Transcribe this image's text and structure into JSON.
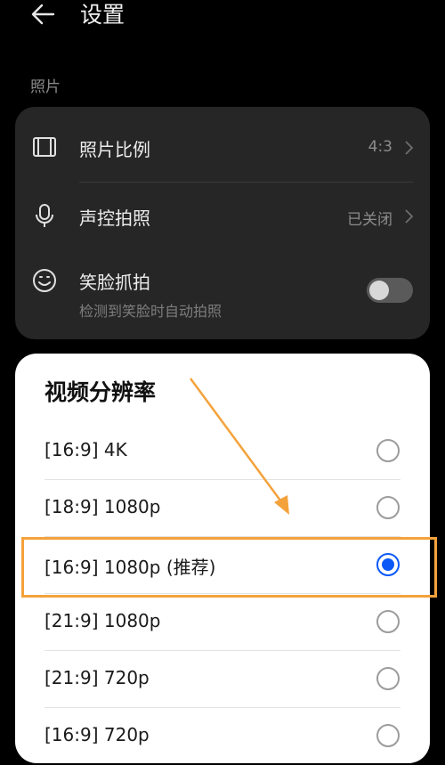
{
  "header": {
    "title": "设置"
  },
  "photo_section": {
    "label": "照片",
    "items": [
      {
        "label": "照片比例",
        "value": "4:3",
        "icon": "aspect-ratio-icon"
      },
      {
        "label": "声控拍照",
        "value": "已关闭",
        "icon": "microphone-icon"
      },
      {
        "label": "笑脸抓拍",
        "sub": "检测到笑脸时自动拍照",
        "icon": "smile-icon",
        "toggle_on": false
      }
    ]
  },
  "resolution_sheet": {
    "title": "视频分辨率",
    "options": [
      {
        "label": "[16:9] 4K",
        "selected": false
      },
      {
        "label": "[18:9] 1080p",
        "selected": false
      },
      {
        "label": "[16:9] 1080p (推荐)",
        "selected": true
      },
      {
        "label": "[21:9] 1080p",
        "selected": false
      },
      {
        "label": "[21:9] 720p",
        "selected": false
      },
      {
        "label": "[16:9] 720p",
        "selected": false
      }
    ]
  },
  "colors": {
    "accent": "#0a59f7",
    "annotation": "#f4a23c",
    "card_bg": "#262626",
    "page_bg": "#000000"
  }
}
